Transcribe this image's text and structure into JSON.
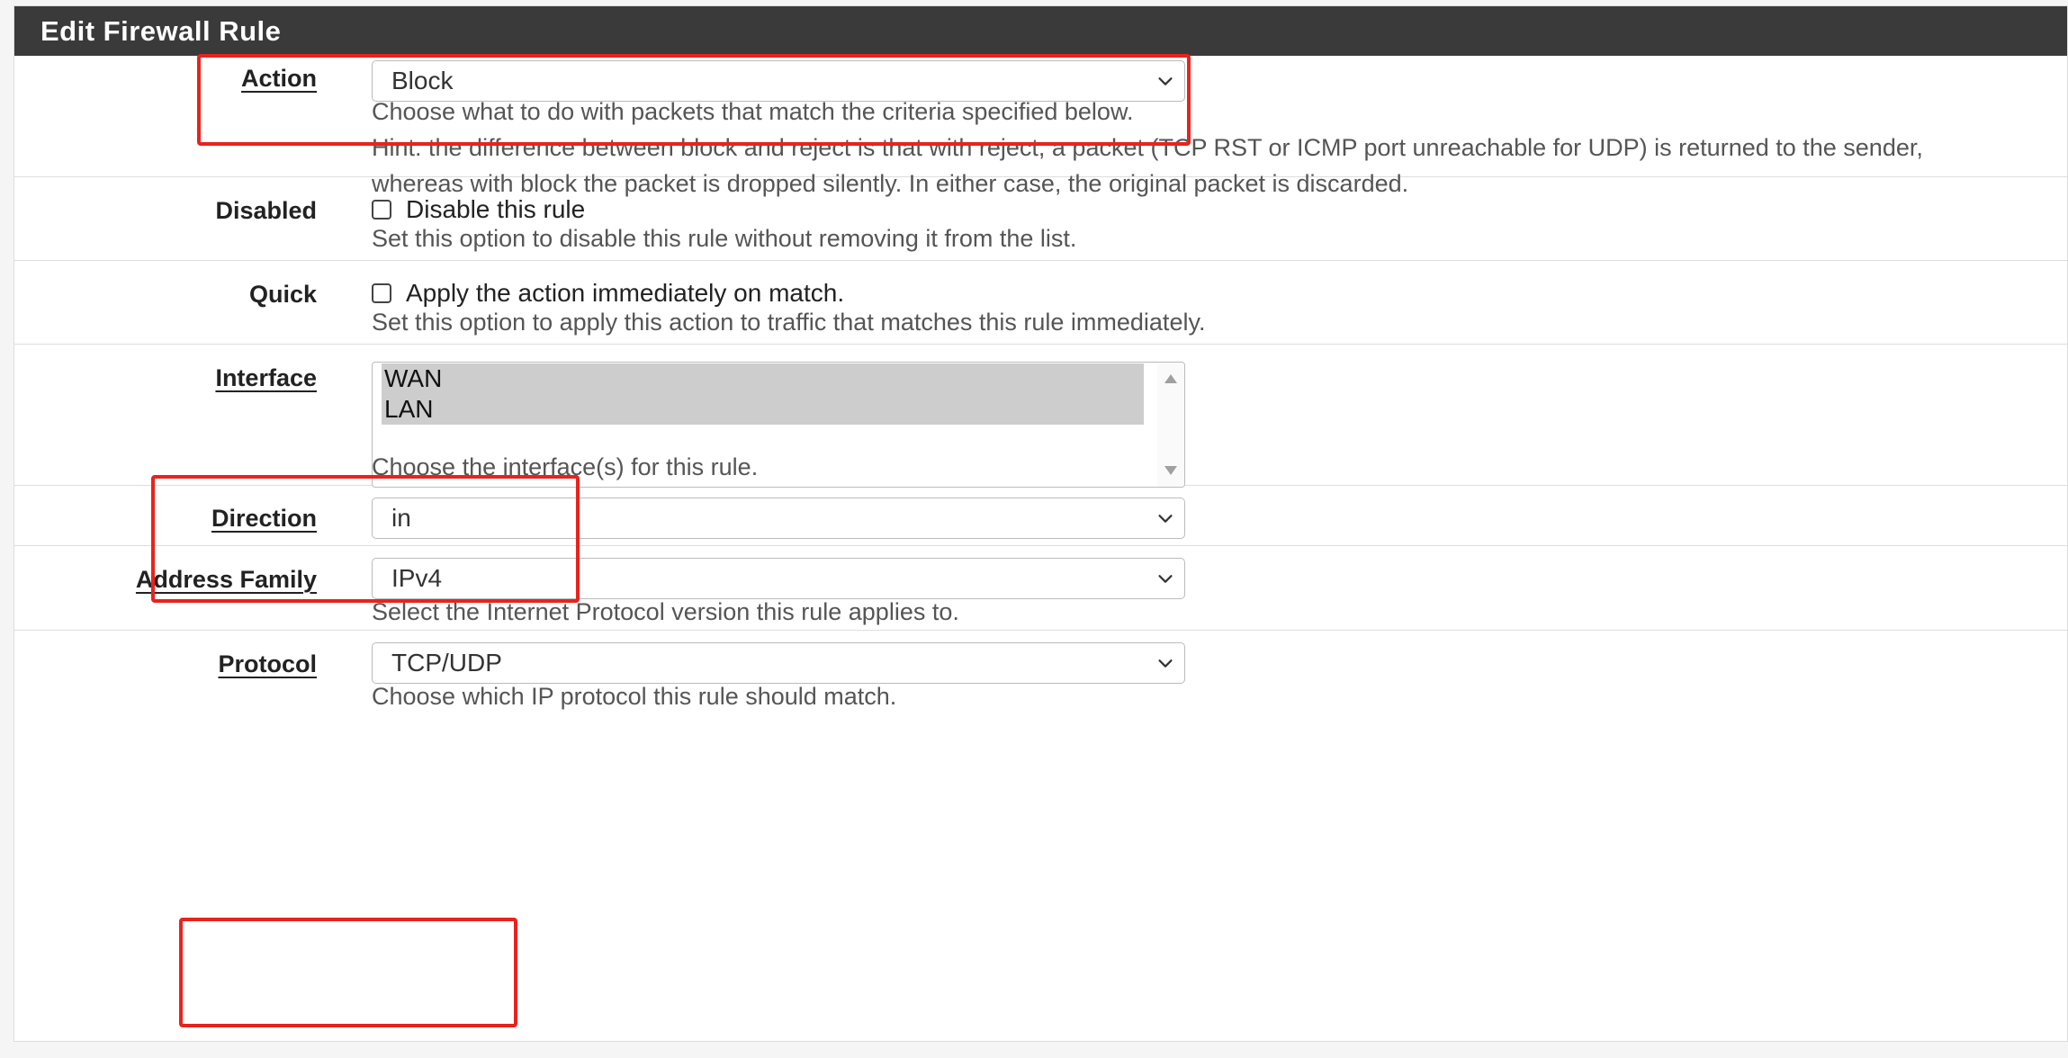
{
  "panel": {
    "title": "Edit Firewall Rule"
  },
  "action": {
    "label": "Action",
    "value": "Block",
    "help_1": "Choose what to do with packets that match the criteria specified below.",
    "help_2": "Hint: the difference between block and reject is that with reject, a packet (TCP RST or ICMP port unreachable for UDP) is returned to the sender,",
    "help_3": "whereas with block the packet is dropped silently. In either case, the original packet is discarded."
  },
  "disabled": {
    "label": "Disabled",
    "checkbox_label": "Disable this rule",
    "checked": false,
    "help": "Set this option to disable this rule without removing it from the list."
  },
  "quick": {
    "label": "Quick",
    "checkbox_label": "Apply the action immediately on match.",
    "checked": false,
    "help": "Set this option to apply this action to traffic that matches this rule immediately."
  },
  "interface": {
    "label": "Interface",
    "options": [
      "WAN",
      "LAN"
    ],
    "help": "Choose the interface(s) for this rule."
  },
  "direction": {
    "label": "Direction",
    "value": "in"
  },
  "address_family": {
    "label": "Address Family",
    "value": "IPv4",
    "help": "Select the Internet Protocol version this rule applies to."
  },
  "protocol": {
    "label": "Protocol",
    "value": "TCP/UDP",
    "help": "Choose which IP protocol this rule should match."
  },
  "colors": {
    "header_bg": "#3a3a3a",
    "highlight": "#e8231d",
    "selected_option_bg": "#cdcdcd"
  },
  "icons": {
    "select_arrow": "chevron-down-icon",
    "scroll_up": "scroll-up-arrow-icon",
    "scroll_down": "scroll-down-arrow-icon"
  }
}
